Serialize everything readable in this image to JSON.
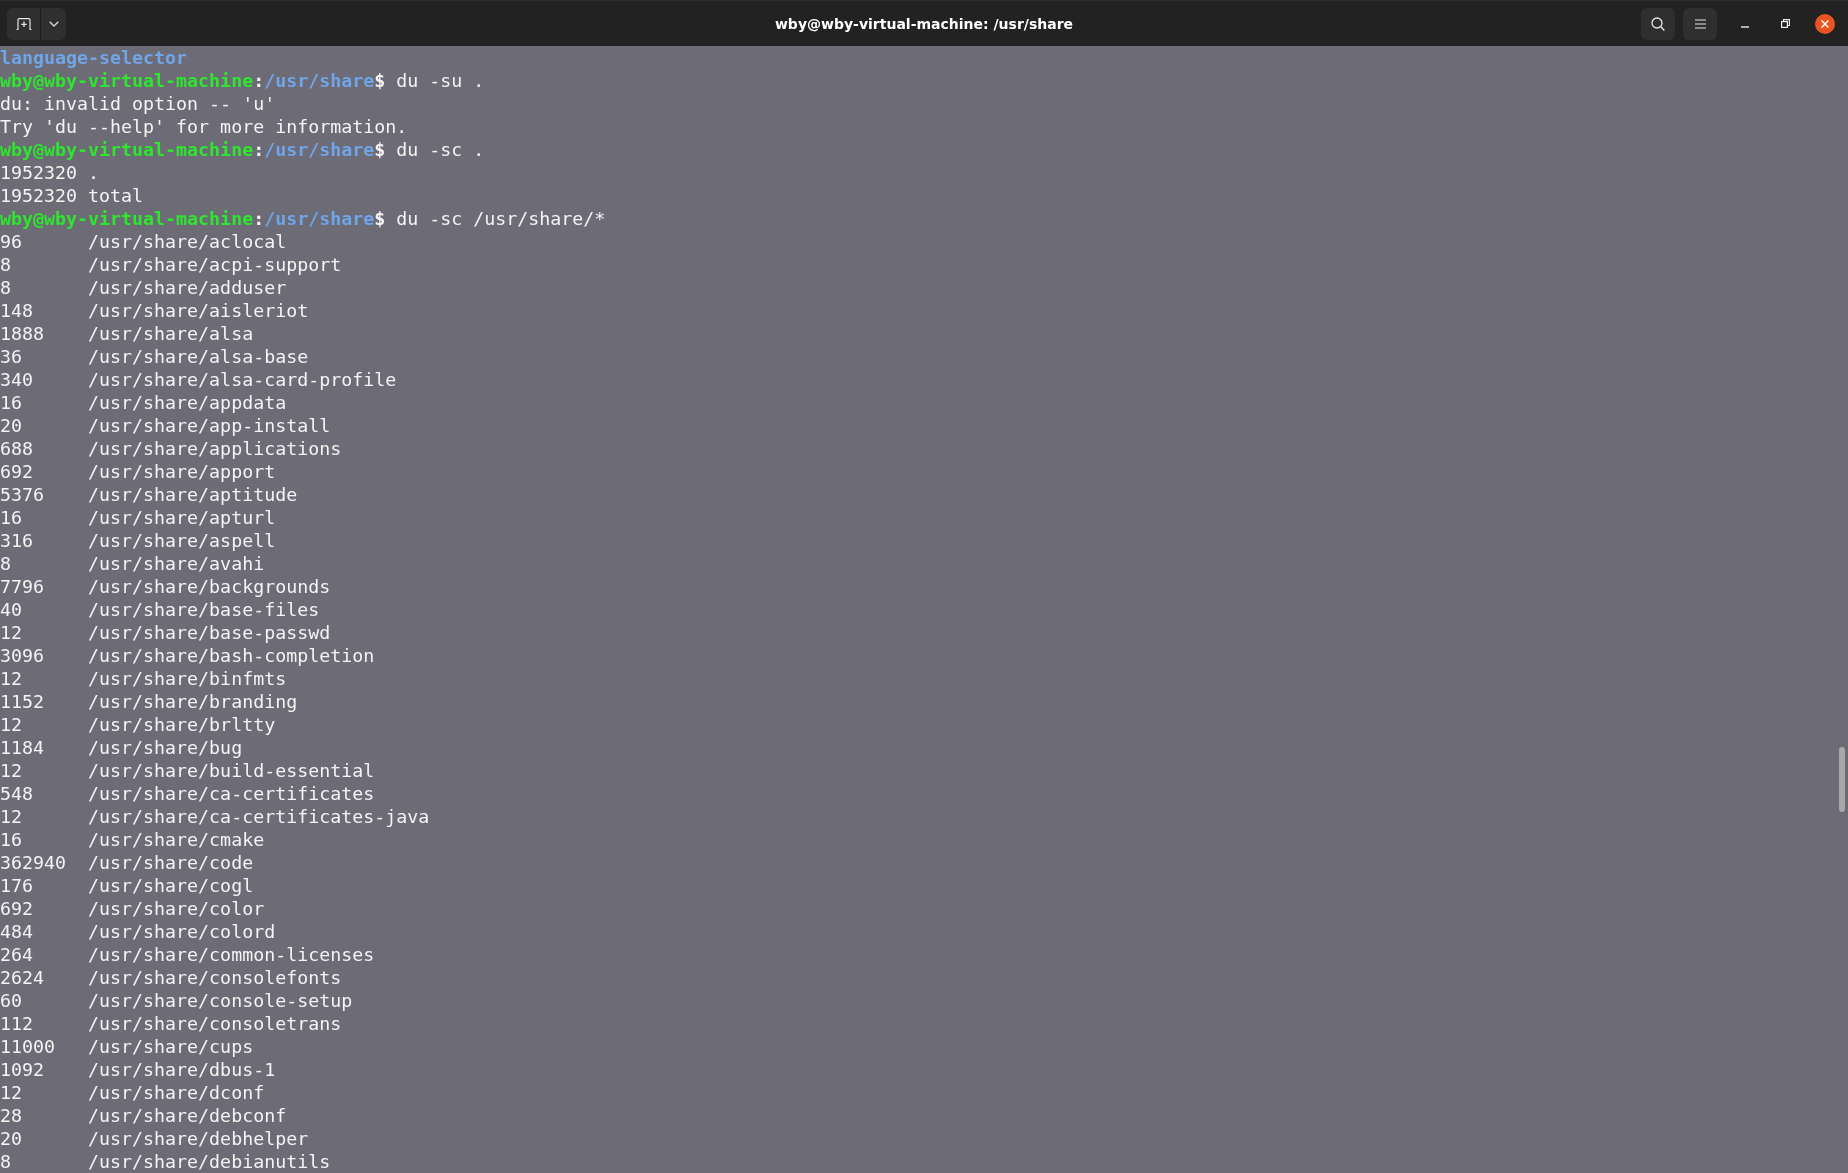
{
  "window": {
    "title": "wby@wby-virtual-machine: /usr/share"
  },
  "terminal": {
    "lines": [
      {
        "kind": "listing",
        "text": "language-selector"
      },
      {
        "kind": "prompt",
        "user_host": "wby@wby-virtual-machine",
        "separator": ":",
        "path": "/usr/share",
        "symbol": "$",
        "command": "du -su ."
      },
      {
        "kind": "output",
        "text": "du: invalid option -- 'u'"
      },
      {
        "kind": "output",
        "text": "Try 'du --help' for more information."
      },
      {
        "kind": "prompt",
        "user_host": "wby@wby-virtual-machine",
        "separator": ":",
        "path": "/usr/share",
        "symbol": "$",
        "command": "du -sc ."
      },
      {
        "kind": "usage",
        "size": "1952320",
        "path": "."
      },
      {
        "kind": "usage",
        "size": "1952320",
        "path": "total"
      },
      {
        "kind": "prompt",
        "user_host": "wby@wby-virtual-machine",
        "separator": ":",
        "path": "/usr/share",
        "symbol": "$",
        "command": "du -sc /usr/share/*"
      },
      {
        "kind": "usage",
        "size": "96",
        "path": "/usr/share/aclocal"
      },
      {
        "kind": "usage",
        "size": "8",
        "path": "/usr/share/acpi-support"
      },
      {
        "kind": "usage",
        "size": "8",
        "path": "/usr/share/adduser"
      },
      {
        "kind": "usage",
        "size": "148",
        "path": "/usr/share/aisleriot"
      },
      {
        "kind": "usage",
        "size": "1888",
        "path": "/usr/share/alsa"
      },
      {
        "kind": "usage",
        "size": "36",
        "path": "/usr/share/alsa-base"
      },
      {
        "kind": "usage",
        "size": "340",
        "path": "/usr/share/alsa-card-profile"
      },
      {
        "kind": "usage",
        "size": "16",
        "path": "/usr/share/appdata"
      },
      {
        "kind": "usage",
        "size": "20",
        "path": "/usr/share/app-install"
      },
      {
        "kind": "usage",
        "size": "688",
        "path": "/usr/share/applications"
      },
      {
        "kind": "usage",
        "size": "692",
        "path": "/usr/share/apport"
      },
      {
        "kind": "usage",
        "size": "5376",
        "path": "/usr/share/aptitude"
      },
      {
        "kind": "usage",
        "size": "16",
        "path": "/usr/share/apturl"
      },
      {
        "kind": "usage",
        "size": "316",
        "path": "/usr/share/aspell"
      },
      {
        "kind": "usage",
        "size": "8",
        "path": "/usr/share/avahi"
      },
      {
        "kind": "usage",
        "size": "7796",
        "path": "/usr/share/backgrounds"
      },
      {
        "kind": "usage",
        "size": "40",
        "path": "/usr/share/base-files"
      },
      {
        "kind": "usage",
        "size": "12",
        "path": "/usr/share/base-passwd"
      },
      {
        "kind": "usage",
        "size": "3096",
        "path": "/usr/share/bash-completion"
      },
      {
        "kind": "usage",
        "size": "12",
        "path": "/usr/share/binfmts"
      },
      {
        "kind": "usage",
        "size": "1152",
        "path": "/usr/share/branding"
      },
      {
        "kind": "usage",
        "size": "12",
        "path": "/usr/share/brltty"
      },
      {
        "kind": "usage",
        "size": "1184",
        "path": "/usr/share/bug"
      },
      {
        "kind": "usage",
        "size": "12",
        "path": "/usr/share/build-essential"
      },
      {
        "kind": "usage",
        "size": "548",
        "path": "/usr/share/ca-certificates"
      },
      {
        "kind": "usage",
        "size": "12",
        "path": "/usr/share/ca-certificates-java"
      },
      {
        "kind": "usage",
        "size": "16",
        "path": "/usr/share/cmake"
      },
      {
        "kind": "usage",
        "size": "362940",
        "path": "/usr/share/code"
      },
      {
        "kind": "usage",
        "size": "176",
        "path": "/usr/share/cogl"
      },
      {
        "kind": "usage",
        "size": "692",
        "path": "/usr/share/color"
      },
      {
        "kind": "usage",
        "size": "484",
        "path": "/usr/share/colord"
      },
      {
        "kind": "usage",
        "size": "264",
        "path": "/usr/share/common-licenses"
      },
      {
        "kind": "usage",
        "size": "2624",
        "path": "/usr/share/consolefonts"
      },
      {
        "kind": "usage",
        "size": "60",
        "path": "/usr/share/console-setup"
      },
      {
        "kind": "usage",
        "size": "112",
        "path": "/usr/share/consoletrans"
      },
      {
        "kind": "usage",
        "size": "11000",
        "path": "/usr/share/cups"
      },
      {
        "kind": "usage",
        "size": "1092",
        "path": "/usr/share/dbus-1"
      },
      {
        "kind": "usage",
        "size": "12",
        "path": "/usr/share/dconf"
      },
      {
        "kind": "usage",
        "size": "28",
        "path": "/usr/share/debconf"
      },
      {
        "kind": "usage",
        "size": "20",
        "path": "/usr/share/debhelper"
      },
      {
        "kind": "usage",
        "size": "8",
        "path": "/usr/share/debianutils"
      }
    ]
  }
}
